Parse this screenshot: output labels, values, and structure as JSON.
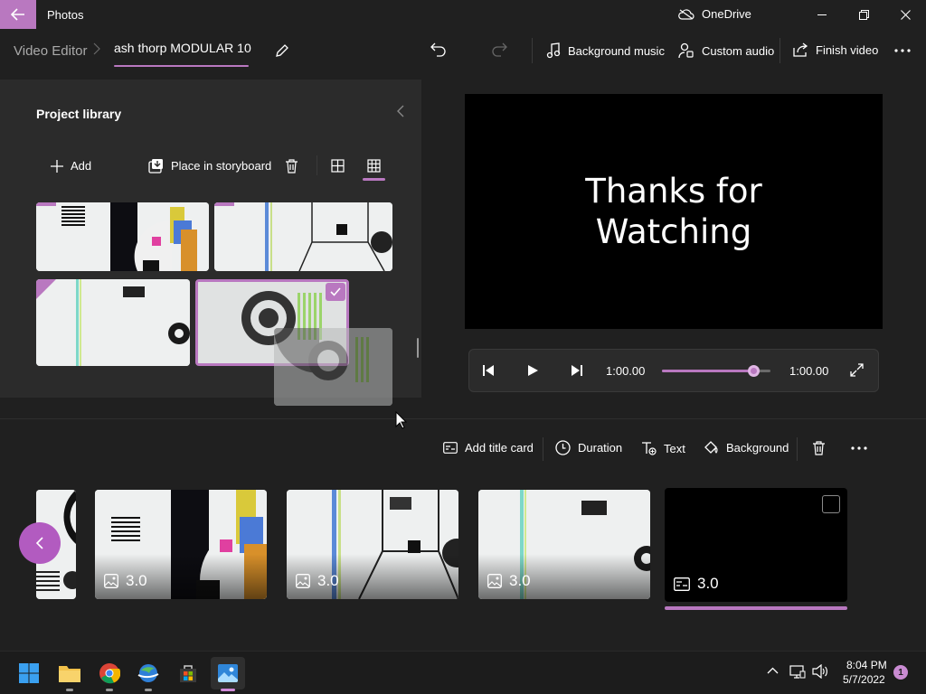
{
  "window": {
    "app_title": "Photos",
    "onedrive_label": "OneDrive"
  },
  "toolbar": {
    "breadcrumb_root": "Video Editor",
    "breadcrumb_sep": ">",
    "project_name": "ash thorp MODULAR 10",
    "background_music": "Background music",
    "custom_audio": "Custom audio",
    "finish_video": "Finish video"
  },
  "library": {
    "title": "Project library",
    "add": "Add",
    "place_in_storyboard": "Place in storyboard"
  },
  "preview": {
    "title_line1": "Thanks for",
    "title_line2": "Watching",
    "current_time": "1:00.00",
    "total_time": "1:00.00",
    "progress": 0.84
  },
  "storyboard_toolbar": {
    "add_title_card": "Add title card",
    "duration": "Duration",
    "text": "Text",
    "background": "Background"
  },
  "storyboard": {
    "cards": [
      {
        "duration": "3.0",
        "kind": "image"
      },
      {
        "duration": "3.0",
        "kind": "image"
      },
      {
        "duration": "3.0",
        "kind": "image"
      },
      {
        "duration": "3.0",
        "kind": "title-card"
      }
    ]
  },
  "taskbar": {
    "time": "8:04 PM",
    "date": "5/7/2022",
    "notification_count": "1"
  },
  "colors": {
    "accent": "#b978c0",
    "background": "#202020",
    "panel": "#2b2b2b"
  }
}
